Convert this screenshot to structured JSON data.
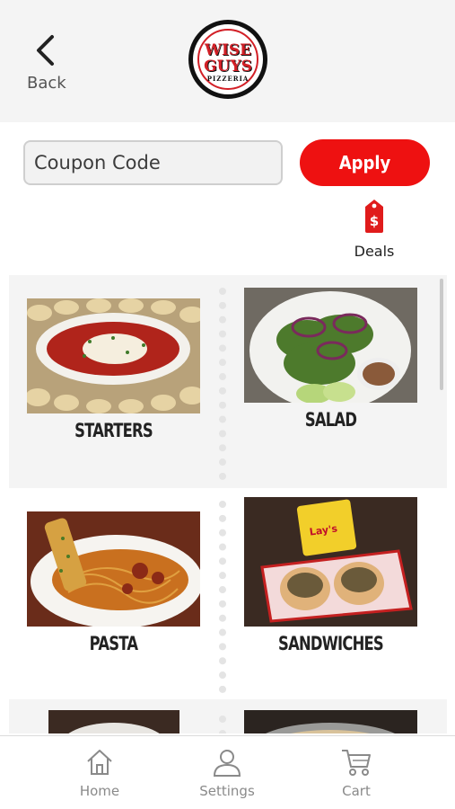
{
  "header": {
    "back_label": "Back",
    "logo": {
      "line1": "WISE",
      "line2": "GUYS",
      "line3": "PIZZERIA"
    }
  },
  "coupon": {
    "placeholder": "Coupon Code",
    "apply_label": "Apply"
  },
  "deals": {
    "label": "Deals",
    "icon": "price-tag-dollar-icon"
  },
  "categories": [
    {
      "label": "STARTERS"
    },
    {
      "label": "SALAD"
    },
    {
      "label": "PASTA"
    },
    {
      "label": "SANDWICHES"
    },
    {
      "label": ""
    },
    {
      "label": ""
    }
  ],
  "bottom_nav": [
    {
      "label": "Home",
      "icon": "home-icon"
    },
    {
      "label": "Settings",
      "icon": "user-icon"
    },
    {
      "label": "Cart",
      "icon": "cart-icon"
    }
  ],
  "colors": {
    "accent": "#ee1111",
    "header_bg": "#f4f4f4",
    "nav_text": "#8a8a8a"
  }
}
